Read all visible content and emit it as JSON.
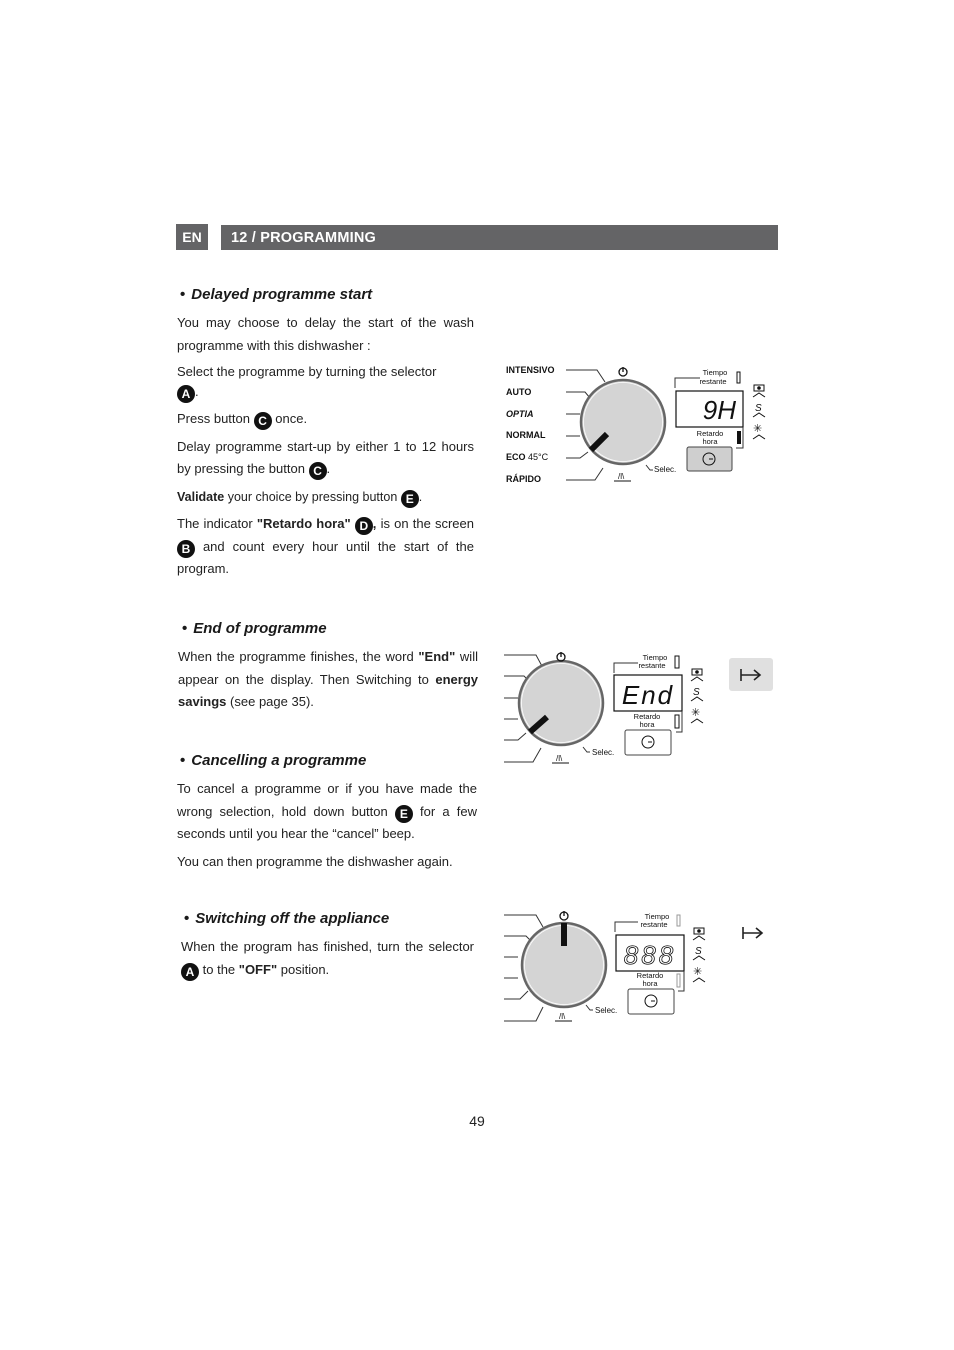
{
  "header": {
    "lang": "EN",
    "section_title": "12 / PROGRAMMING"
  },
  "sections": {
    "delayed": {
      "title": "Delayed programme start",
      "p1": "You may choose to delay the start of the wash programme with this dishwasher :",
      "p2_text": "Select the programme by turning the selector",
      "p2_badge": "A",
      "p3_pre": "Press button",
      "p3_badge": "C",
      "p3_post": "once.",
      "p4_text": "Delay programme start-up by either 1 to 12 hours by pressing the button",
      "p4_badge": "C",
      "p5_bold": "Validate",
      "p5_text": "your choice by pressing button",
      "p5_badge": "E",
      "p6_pre": "The indicator",
      "p6_bold": "\"Retardo hora\"",
      "p6_badge_d": "D",
      "p6_mid": "is on the screen",
      "p6_badge_b": "B",
      "p6_post": "and count every hour until the start of the program."
    },
    "end": {
      "title": "End of programme",
      "p1_pre": "When the programme finishes, the word",
      "p1_bold": "\"End\"",
      "p1_mid": "will appear on the display. Then Switching to",
      "p1_bold2": "energy savings",
      "p1_post": "(see page 35)."
    },
    "cancel": {
      "title": "Cancelling a programme",
      "p1_pre": "To cancel a programme or if you have made the wrong selection, hold down button",
      "p1_badge": "E",
      "p1_post": "for a few seconds until you hear the “cancel” beep.",
      "p2": "You can then programme the dishwasher again."
    },
    "off": {
      "title": "Switching off the appliance",
      "p1_pre": "When the program has finished, turn the selector",
      "p1_badge": "A",
      "p1_mid": "to the",
      "p1_bold": "\"OFF\"",
      "p1_post": "position."
    }
  },
  "panel": {
    "programmes": [
      "INTENSIVO",
      "AUTO",
      "OPTIA",
      "NORMAL",
      "ECO",
      "RÁPIDO"
    ],
    "eco_temp": "45°C",
    "tiempo_line1": "Tiempo",
    "tiempo_line2": "restante",
    "retardo_line1": "Retardo",
    "retardo_line2": "hora",
    "selec": "Selec.",
    "display_1": "9H",
    "display_2": "End",
    "display_3": "888"
  },
  "page_number": "49"
}
